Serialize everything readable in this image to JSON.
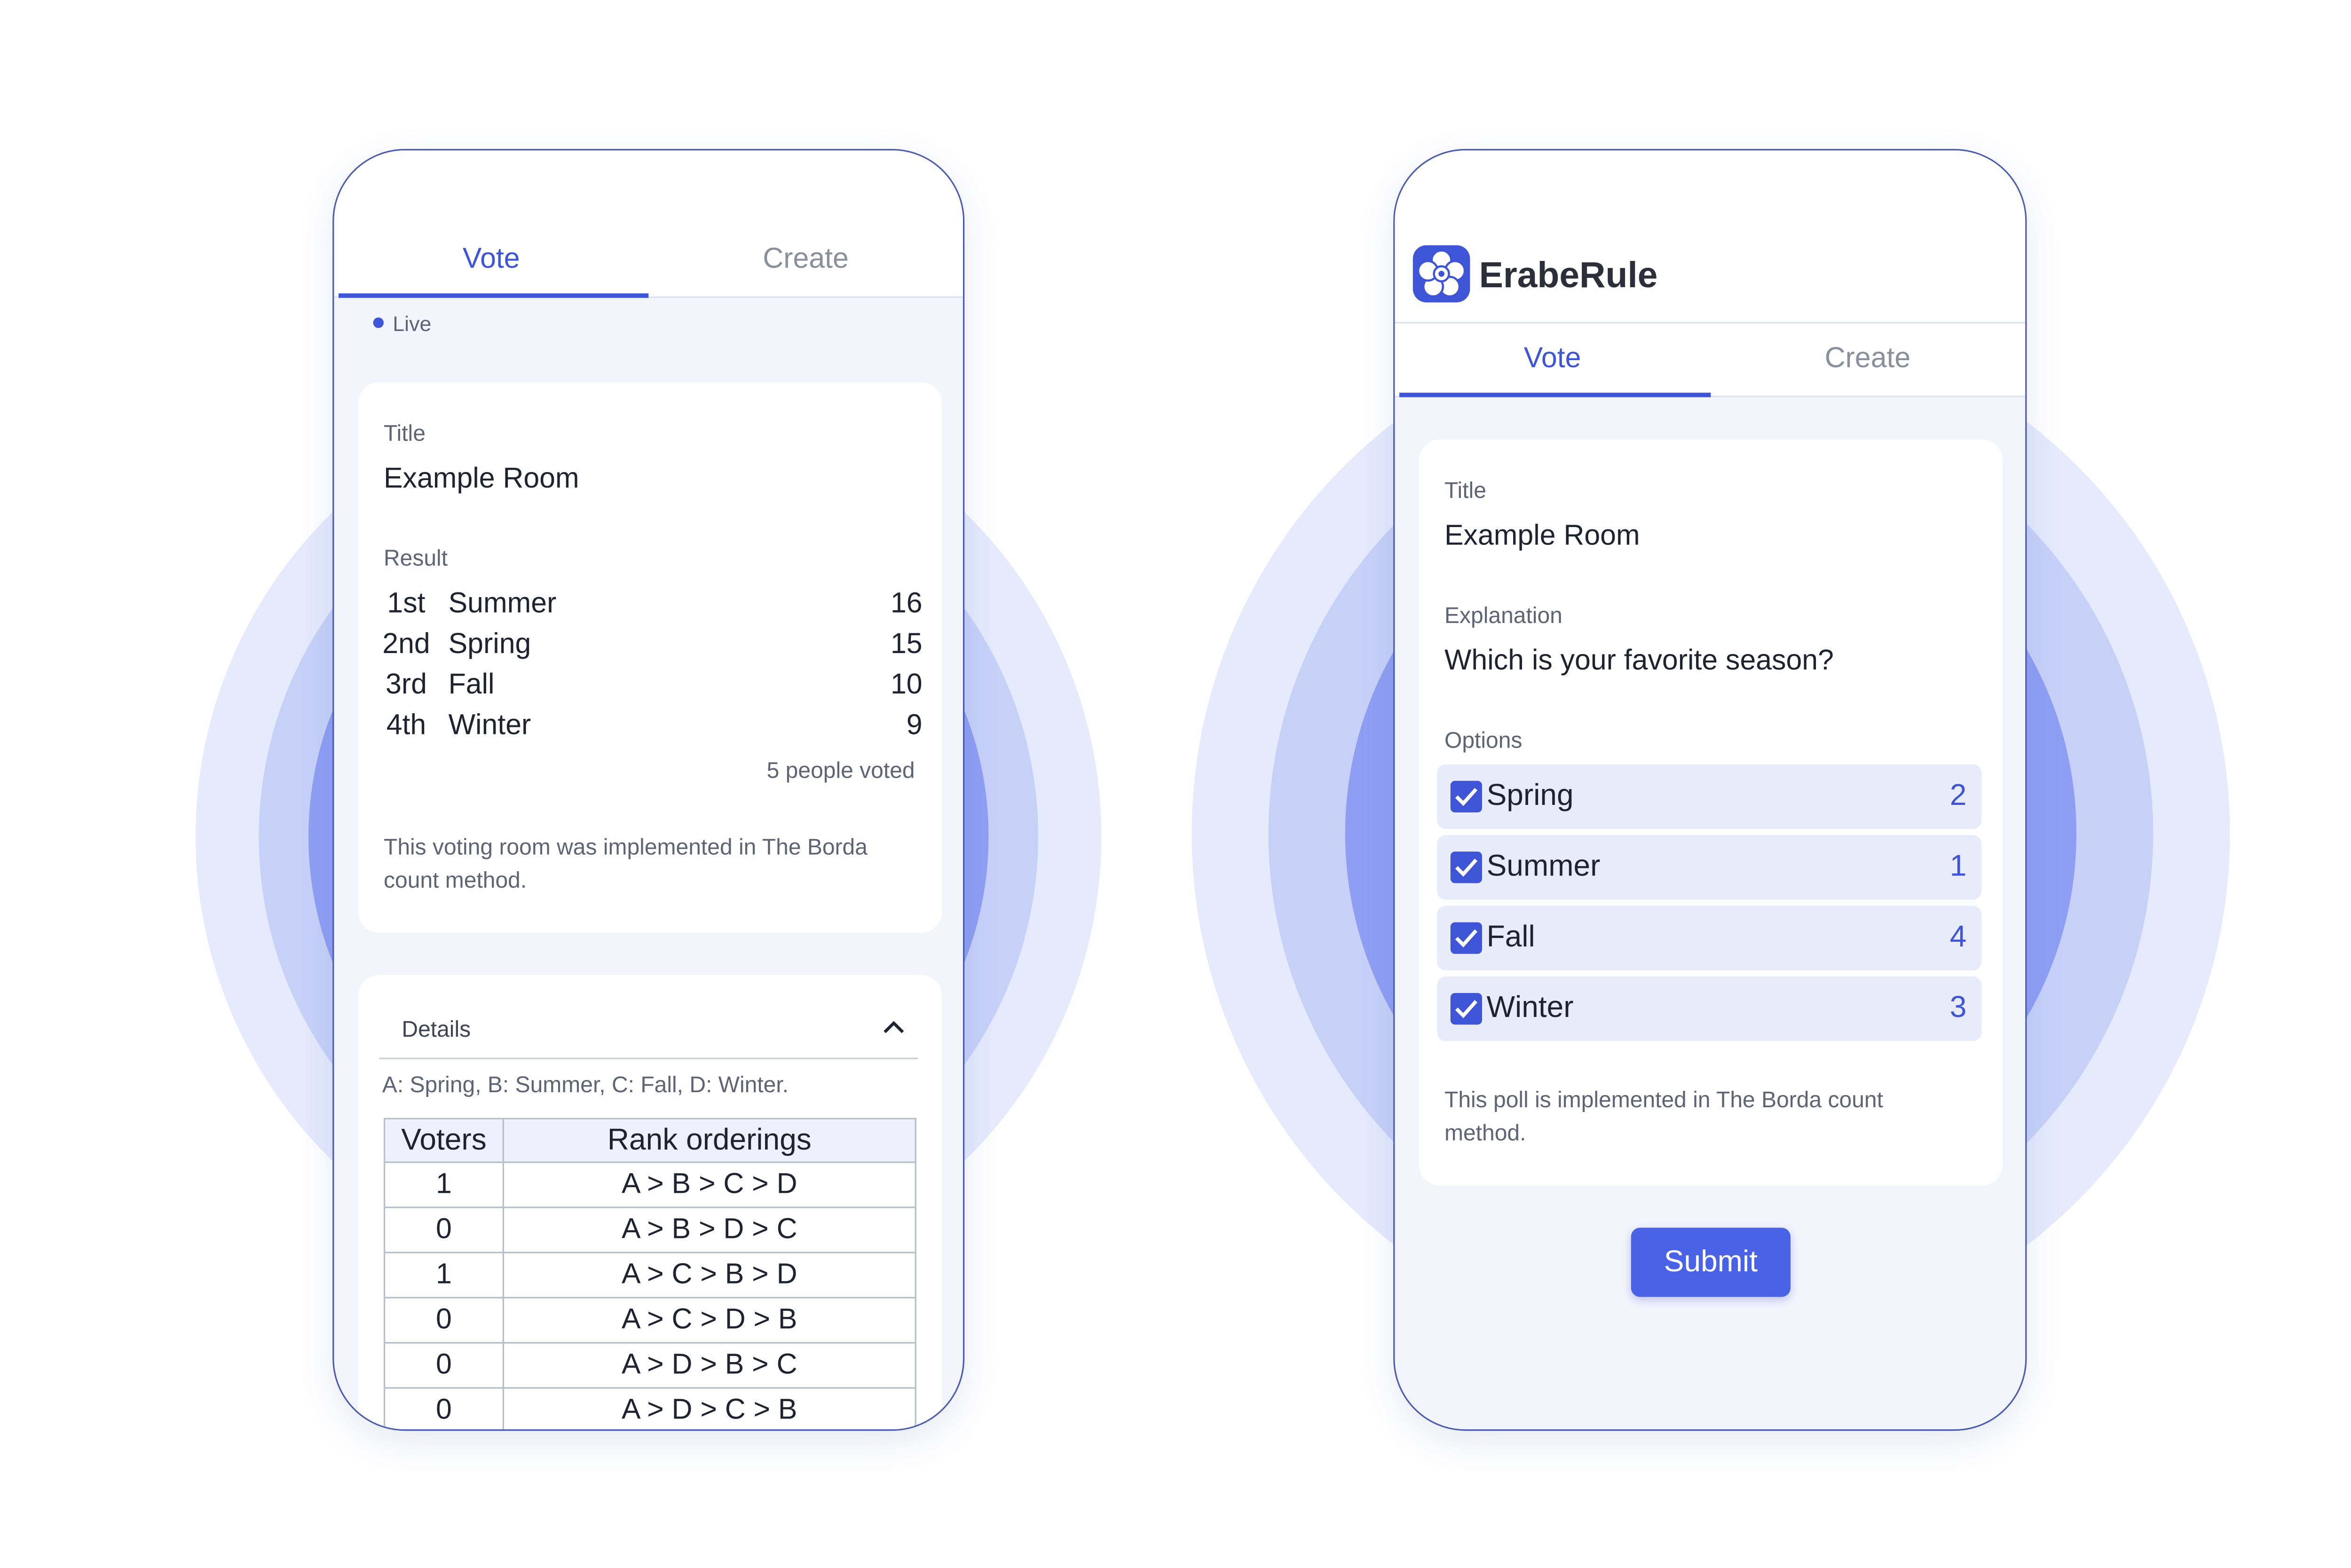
{
  "colors": {
    "accent": "#3d55d6",
    "phone_background": "#f3f5fd",
    "option_background": "#e8ebfa",
    "submit_background": "#4a62e6",
    "ring_outer": "#e5eafd",
    "ring_middle": "#c7d1f8",
    "ring_inner": "#8e9ff3"
  },
  "result_screen": {
    "tabs": [
      "Vote",
      "Create"
    ],
    "active_tab": "Vote",
    "live_label": "Live",
    "title_label": "Title",
    "title_value": "Example Room",
    "result_label": "Result",
    "results": [
      {
        "rank": "1st",
        "name": "Summer",
        "score": "16"
      },
      {
        "rank": "2nd",
        "name": "Spring",
        "score": "15"
      },
      {
        "rank": "3rd",
        "name": "Fall",
        "score": "10"
      },
      {
        "rank": "4th",
        "name": "Winter",
        "score": "9"
      }
    ],
    "voted_count": "5 people voted",
    "method_note": "This voting room was implemented in The Borda count method.",
    "details_label": "Details",
    "legend": "A: Spring, B: Summer, C: Fall, D: Winter.",
    "table_headers": [
      "Voters",
      "Rank orderings"
    ],
    "table_rows": [
      {
        "voters": "1",
        "ordering": "A > B > C > D"
      },
      {
        "voters": "0",
        "ordering": "A > B > D > C"
      },
      {
        "voters": "1",
        "ordering": "A > C > B > D"
      },
      {
        "voters": "0",
        "ordering": "A > C > D > B"
      },
      {
        "voters": "0",
        "ordering": "A > D > B > C"
      },
      {
        "voters": "0",
        "ordering": "A > D > C > B"
      }
    ]
  },
  "vote_screen": {
    "app_name": "ErabeRule",
    "logo_icon": "flower-logo-icon",
    "tabs": [
      "Vote",
      "Create"
    ],
    "active_tab": "Vote",
    "title_label": "Title",
    "title_value": "Example Room",
    "explanation_label": "Explanation",
    "explanation_value": "Which is your favorite season?",
    "options_label": "Options",
    "options": [
      {
        "name": "Spring",
        "count": "2",
        "checked": true
      },
      {
        "name": "Summer",
        "count": "1",
        "checked": true
      },
      {
        "name": "Fall",
        "count": "4",
        "checked": true
      },
      {
        "name": "Winter",
        "count": "3",
        "checked": true
      }
    ],
    "method_note": "This poll is implemented in The Borda count method.",
    "submit_label": "Submit"
  }
}
